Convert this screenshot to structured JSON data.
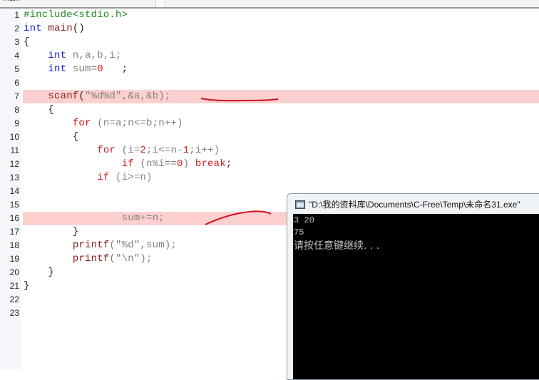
{
  "tab": {
    "label": "main",
    "dropdown_glyph": "▾"
  },
  "editor": {
    "lines": [
      {
        "n": "1"
      },
      {
        "n": "2"
      },
      {
        "n": "3"
      },
      {
        "n": "4"
      },
      {
        "n": "5"
      },
      {
        "n": "6"
      },
      {
        "n": "7"
      },
      {
        "n": "8"
      },
      {
        "n": "9"
      },
      {
        "n": "10"
      },
      {
        "n": "11"
      },
      {
        "n": "12"
      },
      {
        "n": "13"
      },
      {
        "n": "14"
      },
      {
        "n": "15"
      },
      {
        "n": "16"
      },
      {
        "n": "17"
      },
      {
        "n": "18"
      },
      {
        "n": "19"
      },
      {
        "n": "20"
      },
      {
        "n": "21"
      },
      {
        "n": "22"
      },
      {
        "n": "23"
      }
    ],
    "tokens": {
      "l1_pp": "#include<stdio.h>",
      "l2_kw": "int",
      "l2_fn": "main",
      "l2_rest": "()",
      "l3": "{",
      "l4_kw": "int",
      "l4_rest": " n,a,b,i;",
      "l5_kw": "int",
      "l5_a": " sum=",
      "l5_num": "0",
      "l5_b": "   ;",
      "l7_fn": "scanf",
      "l7_p1": "(",
      "l7_str": "\"%d%d\"",
      "l7_rest": ",&a,&b);",
      "l8": "{",
      "l9_kw": "for",
      "l9_rest": " (n=a;n<=b;n++)",
      "l10": "{",
      "l11_kw": "for",
      "l11_a": " (i=",
      "l11_num": "2",
      "l11_b": ";i<=n-",
      "l11_num2": "1",
      "l11_c": ";i++)",
      "l12_kw": "if",
      "l12_a": " (n%i==",
      "l12_num": "0",
      "l12_b": ") ",
      "l12_kw2": "break",
      "l12_c": ";",
      "l13_kw": "if",
      "l13_rest": " (i>=n)",
      "l16": "sum+=n;",
      "l17": "}",
      "l18_fn": "printf",
      "l18_rest": "(\"%d\",sum);",
      "l19_fn": "printf",
      "l19_rest": "(\"\\n\");",
      "l20": "}",
      "l21": "}"
    },
    "highlighted_lines": [
      7,
      16
    ],
    "highlight_color": "#fdd0d0"
  },
  "console": {
    "title": "\"D:\\我的资料库\\Documents\\C-Free\\Temp\\未命名31.exe\"",
    "output": [
      "3 20",
      "75",
      "请按任意键继续. . ."
    ]
  }
}
